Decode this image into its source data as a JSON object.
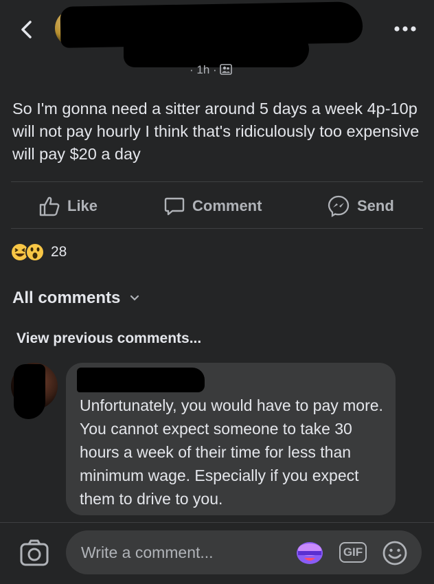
{
  "post": {
    "meta": "· 1h ·",
    "text": "So I'm gonna need a sitter around 5 days a week 4p-10p will not pay hourly I think that's ridiculously too expensive will pay $20 a day"
  },
  "actions": {
    "like": "Like",
    "comment": "Comment",
    "send": "Send"
  },
  "reactions": {
    "count": "28",
    "types": [
      "haha",
      "wow"
    ]
  },
  "comments_section": {
    "filter_label": "All comments",
    "view_previous": "View previous comments..."
  },
  "comment": {
    "text": "Unfortunately, you would have to pay more. You cannot expect someone to take 30 hours a week of their time for less than minimum wage. Especially if you expect them to drive to you."
  },
  "composer": {
    "placeholder": "Write a comment...",
    "gif_label": "GIF"
  },
  "colors": {
    "background": "#242526",
    "bubble": "#3a3b3c",
    "text": "#e4e6eb",
    "secondary": "#b0b3b8"
  }
}
